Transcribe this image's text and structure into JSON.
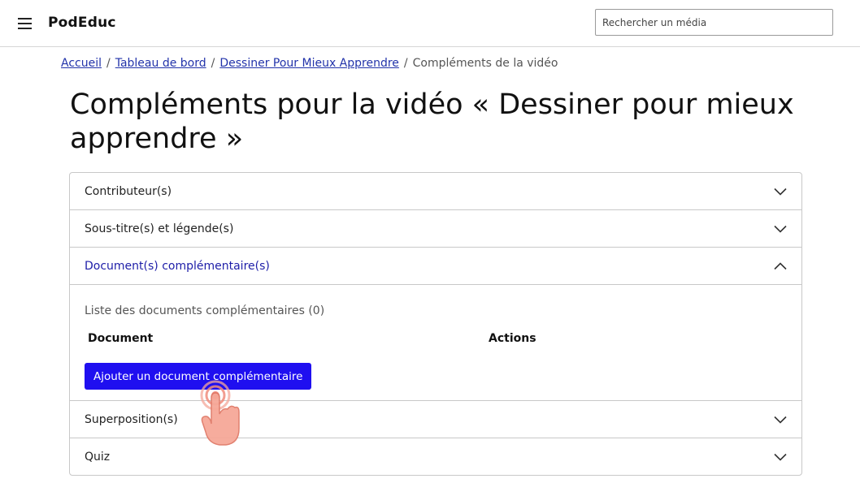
{
  "header": {
    "brand": "PodEduc",
    "search_placeholder": "Rechercher un média"
  },
  "breadcrumb": {
    "items": [
      "Accueil",
      "Tableau de bord",
      "Dessiner Pour Mieux Apprendre"
    ],
    "current": "Compléments de la vidéo",
    "separator": "/"
  },
  "page": {
    "title": "Compléments pour la vidéo « Dessiner pour mieux apprendre »"
  },
  "accordion": {
    "sections": [
      {
        "label": "Contributeur(s)",
        "open": false
      },
      {
        "label": "Sous-titre(s) et légende(s)",
        "open": false
      },
      {
        "label": "Document(s) complémentaire(s)",
        "open": true
      },
      {
        "label": "Superposition(s)",
        "open": false
      },
      {
        "label": "Quiz",
        "open": false
      }
    ],
    "documents": {
      "caption": "Liste des documents complémentaires (0)",
      "columns": [
        "Document",
        "Actions"
      ],
      "add_label": "Ajouter un document complémentaire"
    }
  },
  "colors": {
    "accent": "#1f0ff0",
    "link": "#2233aa",
    "open_header": "#1d1da8",
    "tap_hand": "#f4a79a"
  },
  "icons": [
    "menu-icon",
    "chevron-down-icon",
    "chevron-up-icon",
    "tap-hand-icon"
  ]
}
